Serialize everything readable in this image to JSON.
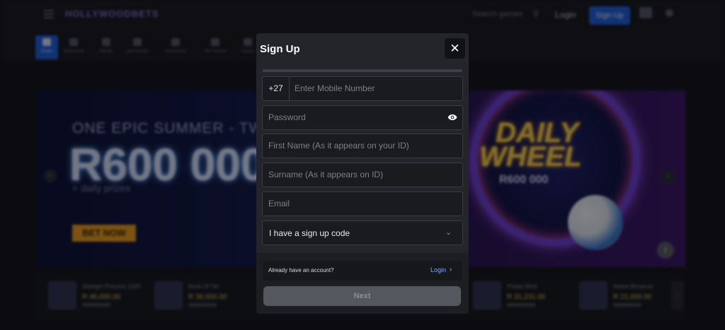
{
  "header": {
    "logo": "HOLLYWOODBETS",
    "search_placeholder": "Search games",
    "login_label": "Login",
    "signup_label": "Sign Up"
  },
  "nav": {
    "items": [
      "Home",
      "Sportsbook",
      "Betslip",
      "Live Games",
      "Promotions",
      "Slot Games",
      "Casino"
    ]
  },
  "banner": {
    "subheading": "ONE EPIC SUMMER - TWO DRAWS",
    "amount": "R600 000",
    "note": "+ daily prizes",
    "cta": "BET NOW",
    "art_title_1": "DAILY",
    "art_title_2": "WHEEL",
    "art_amount": "R600 000"
  },
  "games": [
    {
      "name": "Starlight Princess 1000",
      "value": "R 46,000.00"
    },
    {
      "name": "Book Of Tiki",
      "value": "R 36,000.00"
    },
    {
      "name": "Pinata Wins",
      "value": "R 31,231.00"
    },
    {
      "name": "Sweet Bonanza",
      "value": "R 21,000.00"
    }
  ],
  "modal": {
    "title": "Sign Up",
    "progress_fraction": 0.0,
    "country_code": "+27",
    "mobile_placeholder": "Enter Mobile Number",
    "password_placeholder": "Password",
    "first_name_placeholder": "First Name (As it appears on your ID)",
    "surname_placeholder": "Surname (As it appears on ID)",
    "email_placeholder": "Email",
    "signup_code_label": "I have a sign up code",
    "account_question": "Already have an account?",
    "login_link": "Login",
    "next_label": "Next"
  },
  "colors": {
    "accent": "#1e5fe0",
    "modal_bg": "#24252a",
    "link": "#7ea9ff"
  }
}
